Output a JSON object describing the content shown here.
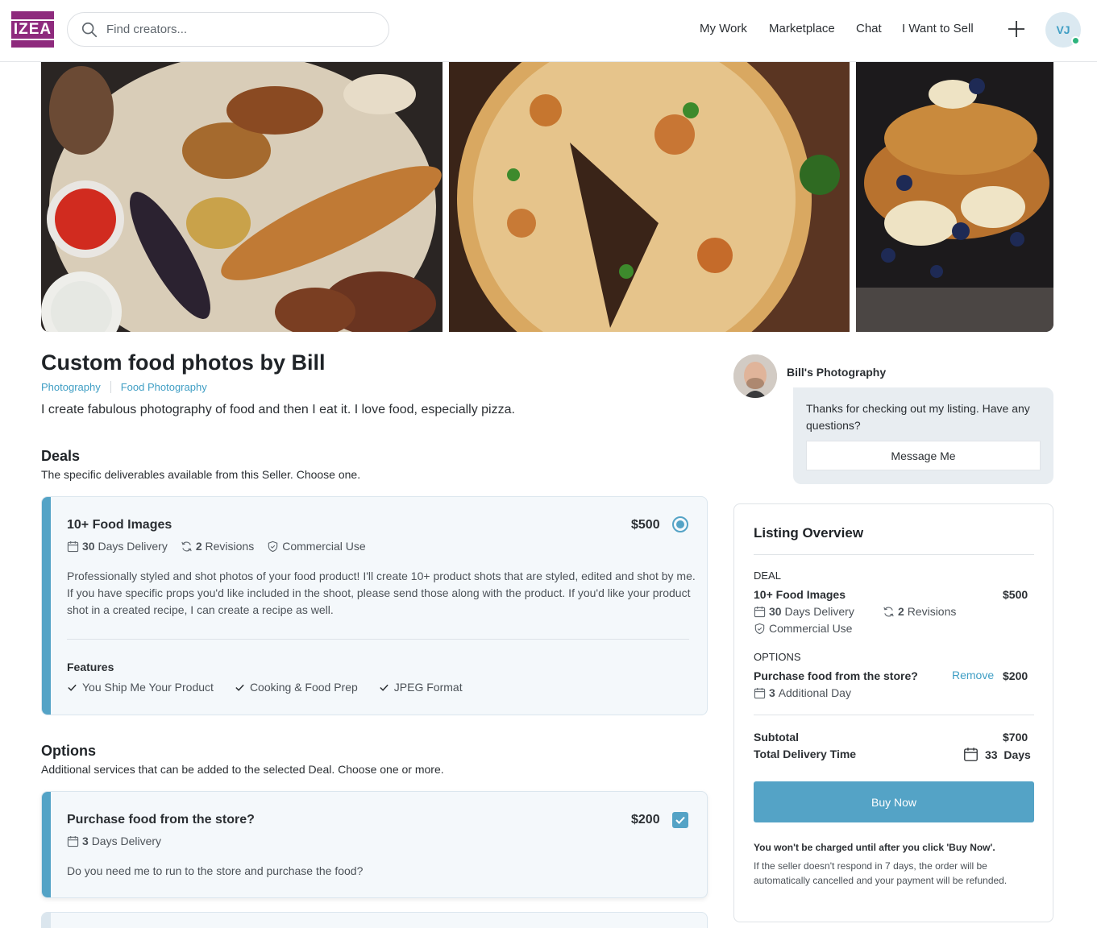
{
  "header": {
    "logo_text": "IZEA",
    "search_placeholder": "Find creators...",
    "nav": [
      "My Work",
      "Marketplace",
      "Chat",
      "I Want to Sell"
    ],
    "avatar_initials": "VJ"
  },
  "listing": {
    "title": "Custom food photos by Bill",
    "tags": [
      "Photography",
      "Food Photography"
    ],
    "description": "I create fabulous photography of food and then I eat it. I love food, especially pizza."
  },
  "deals": {
    "heading": "Deals",
    "subheading": "The specific deliverables available from this Seller. Choose one.",
    "items": [
      {
        "title": "10+ Food Images",
        "price": "$500",
        "delivery_num": "30",
        "delivery_label": "Days Delivery",
        "revisions_num": "2",
        "revisions_label": "Revisions",
        "usage": "Commercial Use",
        "description": "Professionally styled and shot photos of your food product! I'll create 10+ product shots that are styled, edited and shot by me. If you have specific props you'd like included in the shoot, please send those along with the product. If you'd like your product shot in a created recipe, I can create a recipe as well.",
        "features_title": "Features",
        "features": [
          "You Ship Me Your Product",
          "Cooking & Food Prep",
          "JPEG Format"
        ]
      }
    ]
  },
  "options": {
    "heading": "Options",
    "subheading": "Additional services that can be added to the selected Deal. Choose one or more.",
    "items": [
      {
        "title": "Purchase food from the store?",
        "price": "$200",
        "delivery_num": "3",
        "delivery_label": "Days Delivery",
        "description": "Do you need me to run to the store and purchase the food?"
      }
    ]
  },
  "seller": {
    "name": "Bill's Photography",
    "message": "Thanks for checking out my listing. Have any questions?",
    "message_button": "Message Me"
  },
  "overview": {
    "title": "Listing Overview",
    "deal_label": "DEAL",
    "deal_name": "10+ Food Images",
    "deal_price": "$500",
    "deal_delivery_num": "30",
    "deal_delivery_label": "Days Delivery",
    "deal_revisions_num": "2",
    "deal_revisions_label": "Revisions",
    "deal_usage": "Commercial Use",
    "options_label": "OPTIONS",
    "option_name": "Purchase food from the store?",
    "option_remove": "Remove",
    "option_price": "$200",
    "option_delivery_num": "3",
    "option_delivery_label": "Additional Day",
    "subtotal_label": "Subtotal",
    "subtotal_value": "$700",
    "total_time_label": "Total Delivery Time",
    "total_time_num": "33",
    "total_time_unit": "Days",
    "buy_button": "Buy Now",
    "note_bold": "You won't be charged until after you click 'Buy Now'.",
    "note": "If the seller doesn't respond in 7 days, the order will be automatically cancelled and your payment will be refunded."
  },
  "colors": {
    "accent": "#54a3c6",
    "brand": "#8e2a7d",
    "link": "#3f9ec4",
    "online": "#2db47d"
  }
}
